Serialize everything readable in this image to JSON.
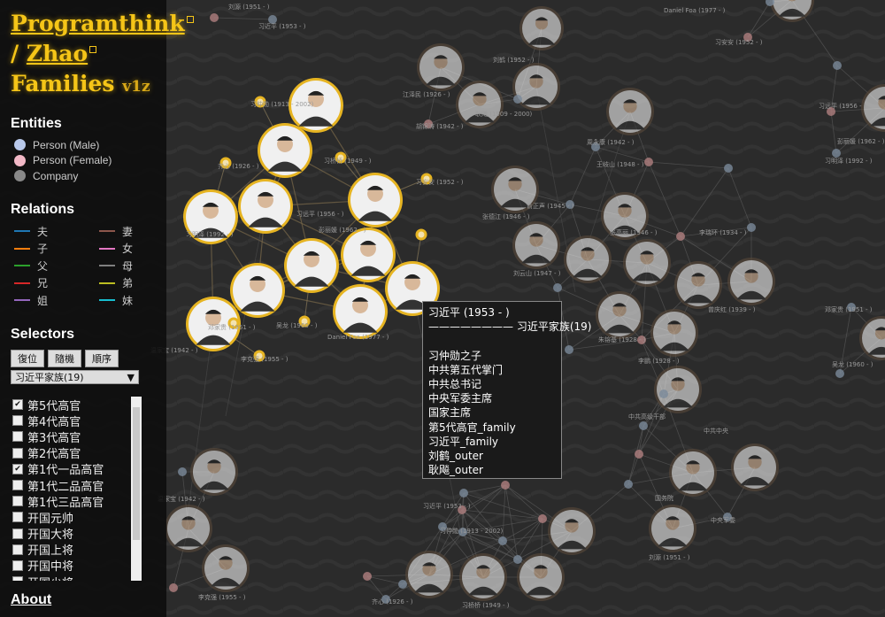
{
  "sidebar": {
    "title_line1": "Programthink",
    "title_line2_prefix": "/ ",
    "title_line2": "Zhao",
    "title_line3": "Families",
    "version": "v1z",
    "entities_heading": "Entities",
    "entities": [
      {
        "label": "Person (Male)",
        "color": "#b8c8ea"
      },
      {
        "label": "Person (Female)",
        "color": "#f2b8c6"
      },
      {
        "label": "Company",
        "color": "#888888"
      }
    ],
    "relations_heading": "Relations",
    "relations": [
      {
        "label": "夫",
        "color": "#1f77b4"
      },
      {
        "label": "妻",
        "color": "#8c564b"
      },
      {
        "label": "子",
        "color": "#ff7f0e"
      },
      {
        "label": "女",
        "color": "#e377c2"
      },
      {
        "label": "父",
        "color": "#2ca02c"
      },
      {
        "label": "母",
        "color": "#7f7f7f"
      },
      {
        "label": "兄",
        "color": "#d62728"
      },
      {
        "label": "弟",
        "color": "#bcbd22"
      },
      {
        "label": "姐",
        "color": "#9467bd"
      },
      {
        "label": "妹",
        "color": "#17becf"
      }
    ],
    "selectors_heading": "Selectors",
    "buttons": {
      "reset": "復位",
      "random": "隨機",
      "order": "順序"
    },
    "select_value": "习近平家族(19)",
    "checklist": [
      {
        "label": "第5代高官",
        "checked": true
      },
      {
        "label": "第4代高官",
        "checked": false
      },
      {
        "label": "第3代高官",
        "checked": false
      },
      {
        "label": "第2代高官",
        "checked": false
      },
      {
        "label": "第1代一品高官",
        "checked": true
      },
      {
        "label": "第1代二品高官",
        "checked": false
      },
      {
        "label": "第1代三品高官",
        "checked": false
      },
      {
        "label": "开国元帅",
        "checked": false
      },
      {
        "label": "开国大将",
        "checked": false
      },
      {
        "label": "开国上将",
        "checked": false
      },
      {
        "label": "开国中将",
        "checked": false
      },
      {
        "label": "开国少将",
        "checked": false
      }
    ],
    "about": "About"
  },
  "tooltip": {
    "name": "习近平 (1953 - )",
    "family_line": "———————— 习近平家族(19)",
    "details": [
      "习仲勋之子",
      "中共第五代掌门",
      "中共总书记",
      "中央军委主席",
      "国家主席",
      "第5代高官_family",
      "习近平_family",
      "刘鹤_outer",
      "耿飚_outer"
    ]
  },
  "graph": {
    "colors": {
      "highlight": "#e6b422",
      "node_ring": "#5a4a3a",
      "link": "#666666",
      "dot_male": "#7a8a9a",
      "dot_female": "#b08080",
      "background": "#2b2b2b"
    },
    "labels": [
      "刘源 (1951 - )",
      "习近平 (1953 - )",
      "习仲勋 (1913 - 2002)",
      "齐心 (1926 - )",
      "习桥桥 (1949 - )",
      "习安安 (1952 - )",
      "习远平 (1956 - )",
      "彭丽媛 (1962 - )",
      "习明泽 (1992 - )",
      "邓家贵 (1951 - )",
      "吴龙 (1960 - )",
      "Daniel Foa (1977 - )",
      "温家宝 (1942 - )",
      "李克强 (1955 - )",
      "江泽民 (1926 - )",
      "胡锦涛 (1942 - )",
      "刘鹤 (1952 - )",
      "耿飚 (1909 - 2000)",
      "周永康 (1942 - )",
      "王岐山 (1948 - )",
      "张德江 (1946 - )",
      "俞正声 (1945 - )",
      "刘云山 (1947 - )",
      "张高丽 (1946 - )",
      "李瑞环 (1934 - )",
      "曾庆红 (1939 - )",
      "朱镕基 (1928 - )",
      "李鹏 (1928 - )",
      "中共高级干部",
      "中共中央",
      "国务院",
      "中央军委"
    ]
  }
}
